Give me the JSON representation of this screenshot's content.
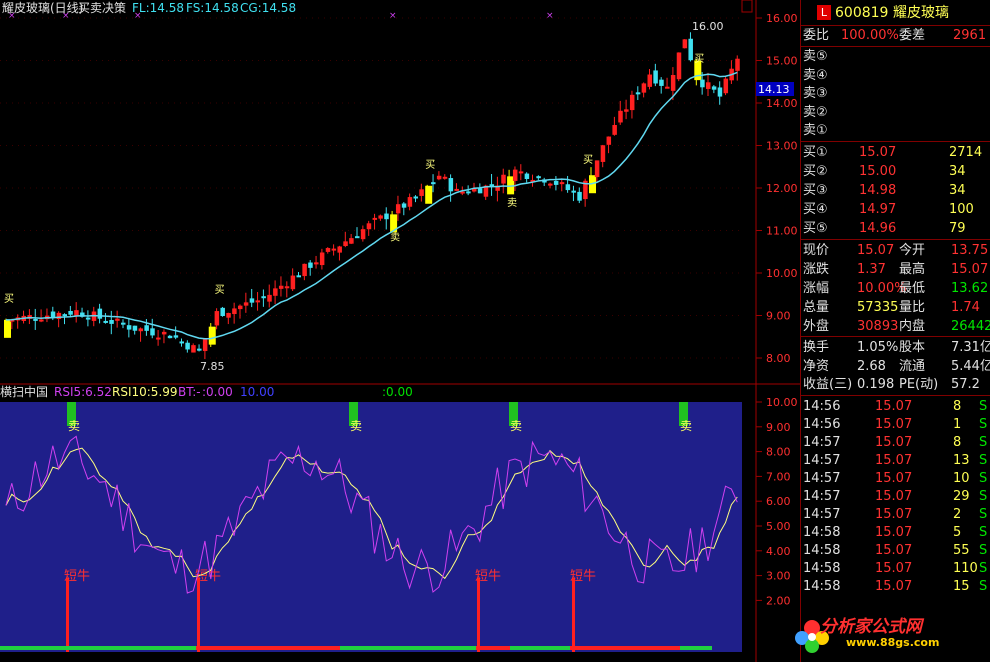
{
  "header": {
    "title": "耀皮玻璃(日线)",
    "indicator": "买卖决策",
    "fl": "FL:14.58",
    "fs": "FS:14.58",
    "cg": "CG:14.58"
  },
  "main_chart": {
    "price_ticks": [
      "16.00",
      "15.00",
      "14.00",
      "13.00",
      "12.00",
      "11.00",
      "10.00",
      "9.00",
      "8.00"
    ],
    "current_price_label": "14.13",
    "high_label": "16.00",
    "low_label": "7.85",
    "buy_marker": "买",
    "sell_marker": "卖"
  },
  "sub_chart": {
    "title": "横扫中国",
    "rsi5": "RSI5:6.52",
    "rsi10": "RSI10:5.99",
    "bt": "BT:-",
    "bt_v": ":0.00",
    "v10": "10.00",
    "v0": ":0.00",
    "ticks": [
      "10.00",
      "9.00",
      "8.00",
      "7.00",
      "6.00",
      "5.00",
      "4.00",
      "3.00",
      "2.00"
    ],
    "buy_label": "短牛",
    "sell_label": "卖"
  },
  "quote": {
    "badge": "L",
    "code": "600819",
    "name": "耀皮玻璃",
    "weibi_label": "委比",
    "weibi": "100.00%",
    "weicha_label": "委差",
    "weicha": "2961",
    "sell": [
      {
        "label": "卖⑤"
      },
      {
        "label": "卖④"
      },
      {
        "label": "卖③"
      },
      {
        "label": "卖②"
      },
      {
        "label": "卖①"
      }
    ],
    "buy": [
      {
        "label": "买①",
        "price": "15.07",
        "vol": "2714"
      },
      {
        "label": "买②",
        "price": "15.00",
        "vol": "34"
      },
      {
        "label": "买③",
        "price": "14.98",
        "vol": "34"
      },
      {
        "label": "买④",
        "price": "14.97",
        "vol": "100"
      },
      {
        "label": "买⑤",
        "price": "14.96",
        "vol": "79"
      }
    ],
    "stats": [
      {
        "l1": "现价",
        "v1": "15.07",
        "l2": "今开",
        "v2": "13.75"
      },
      {
        "l1": "涨跌",
        "v1": "1.37",
        "l2": "最高",
        "v2": "15.07"
      },
      {
        "l1": "涨幅",
        "v1": "10.00%",
        "l2": "最低",
        "v2": "13.62"
      },
      {
        "l1": "总量",
        "v1": "57335",
        "l2": "量比",
        "v2": "1.74"
      },
      {
        "l1": "外盘",
        "v1": "30893",
        "l2": "内盘",
        "v2": "26442"
      }
    ],
    "fund": [
      {
        "l1": "换手",
        "v1": "1.05%",
        "l2": "股本",
        "v2": "7.31亿"
      },
      {
        "l1": "净资",
        "v1": "2.68",
        "l2": "流通",
        "v2": "5.44亿"
      },
      {
        "l1": "收益(三)",
        "v1": "0.198",
        "l2": "PE(动)",
        "v2": "57.2"
      }
    ],
    "ticks": [
      {
        "time": "14:56",
        "price": "15.07",
        "vol": "8",
        "side": "S"
      },
      {
        "time": "14:56",
        "price": "15.07",
        "vol": "1",
        "side": "S"
      },
      {
        "time": "14:57",
        "price": "15.07",
        "vol": "8",
        "side": "S"
      },
      {
        "time": "14:57",
        "price": "15.07",
        "vol": "13",
        "side": "S"
      },
      {
        "time": "14:57",
        "price": "15.07",
        "vol": "10",
        "side": "S"
      },
      {
        "time": "14:57",
        "price": "15.07",
        "vol": "29",
        "side": "S"
      },
      {
        "time": "14:57",
        "price": "15.07",
        "vol": "2",
        "side": "S"
      },
      {
        "time": "14:58",
        "price": "15.07",
        "vol": "5",
        "side": "S"
      },
      {
        "time": "14:58",
        "price": "15.07",
        "vol": "55",
        "side": "S"
      },
      {
        "time": "14:58",
        "price": "15.07",
        "vol": "110",
        "side": "S"
      },
      {
        "time": "14:58",
        "price": "15.07",
        "vol": "15",
        "side": "S"
      }
    ]
  },
  "logo": {
    "text": "分析家公式网",
    "url": "www.88gs.com"
  },
  "colors": {
    "up": "#ff2020",
    "down": "#40e0f0",
    "ma": "#60d8f0",
    "signal": "#ffff00",
    "sub_bg": "#1f1f8a",
    "rsi_fast": "#d040f0",
    "rsi_slow": "#ffff80"
  }
}
